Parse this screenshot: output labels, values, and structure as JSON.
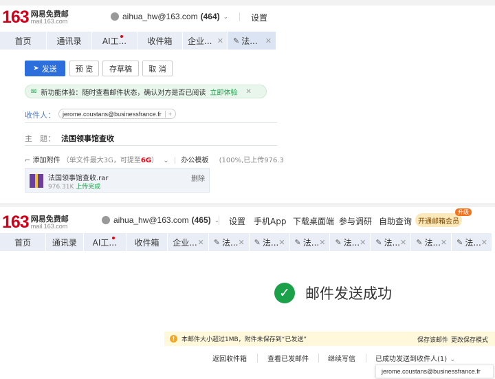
{
  "logo": {
    "number": "163",
    "name": "网易免费邮",
    "domain": "mail.163.com"
  },
  "top": {
    "account": "aihua_hw@163.com",
    "count": "(464)",
    "settings": "设置"
  },
  "tabs": [
    "首页",
    "通讯录",
    "AI工...",
    "收件箱",
    "企业...",
    "法..."
  ],
  "compose": {
    "send": "发送",
    "preview": "预 览",
    "draft": "存草稿",
    "cancel": "取 消"
  },
  "banner": {
    "text": "新功能体验：随时查看邮件状态，确认对方是否已阅读",
    "link": "立即体验"
  },
  "recipients": {
    "label": "收件人：",
    "value": "jerome.coustans@businessfrance.fr"
  },
  "subject": {
    "label": "主　题：",
    "value": "法国领事馆查收"
  },
  "attach": {
    "add": "添加附件",
    "limit": "（单文件最大3G，可提至",
    "size": "6G",
    "limit_end": "）",
    "templates": "办公模板",
    "progress": "(100%,已上传976.3"
  },
  "file": {
    "name": "法国领事馆查收.rar",
    "size": "976.31K",
    "status": "上传完成",
    "delete": "删除"
  },
  "top2": {
    "account": "aihua_hw@163.com",
    "count": "(465)",
    "links": [
      "设置",
      "手机App",
      "下载桌面端",
      "参与调研",
      "自助查询"
    ],
    "vip": "开通邮箱会员",
    "upgrade": "升级"
  },
  "tabs2": [
    "首页",
    "通讯录",
    "AI工...",
    "收件箱",
    "企业...",
    "法...",
    "法...",
    "法...",
    "法...",
    "法...",
    "法...",
    "法..."
  ],
  "success": "邮件发送成功",
  "warning": {
    "text": "本邮件大小超过1MB，附件未保存到“已发送”",
    "save": "保存该邮件",
    "change": "更改保存模式"
  },
  "actions": [
    "返回收件箱",
    "查看已发邮件",
    "继续写信",
    "已成功发送到收件人(1)"
  ],
  "sent_to": "jerome.coustans@businessfrance.fr"
}
